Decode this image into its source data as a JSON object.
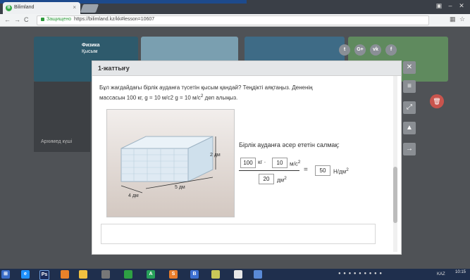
{
  "browser": {
    "tab_title": "Bilimland",
    "tab_close": "×",
    "url_secure_label": "Защищено",
    "url": "https://bilimland.kz/kk#lesson=10607"
  },
  "site": {
    "breadcrumb_subject": "Физика",
    "breadcrumb_topic": "Қысым",
    "card_caption": "Архимед күші",
    "social": [
      "twitter-icon",
      "google-plus-icon",
      "vk-icon",
      "facebook-icon"
    ]
  },
  "modal": {
    "title": "1-жаттығу",
    "question_line1": "Бұл жағдайдағы бірлік ауданға түсетін қысым қандай? Теңдікті аяқтаңыз. Дененің",
    "question_line2": "массасын 100 кг, g = 10 м/с2  g = 10 м/с",
    "question_sup": "2",
    "question_tail": " деп алыңыз.",
    "illustration": {
      "dim_height": "2 дм",
      "dim_length": "5 дм",
      "dim_width": "4 дм"
    },
    "calc": {
      "label": "Бірлік ауданға әсер ететін салмақ:",
      "mass_value": "100",
      "mass_unit": "кг ·",
      "g_value": "10",
      "g_unit": "м/с",
      "g_unit_sup": "2",
      "area_value": "20",
      "area_unit": "дм",
      "area_unit_sup": "2",
      "equals": "=",
      "result_value": "50",
      "result_unit": "Н/дм",
      "result_unit_sup": "2"
    }
  },
  "side_tools": [
    "close-icon",
    "menu-icon",
    "expand-icon",
    "warning-icon",
    "arrow-right-icon"
  ],
  "taskbar": {
    "apps": [
      "e",
      "Ps",
      "",
      "",
      "",
      "A",
      "S",
      "B",
      "",
      "",
      ""
    ],
    "clock_time": "10:15",
    "lang": "KAZ"
  },
  "colors": {
    "accent_green": "#39a94a",
    "modal_header": "#e4e6e8",
    "trash": "#c9544d"
  }
}
